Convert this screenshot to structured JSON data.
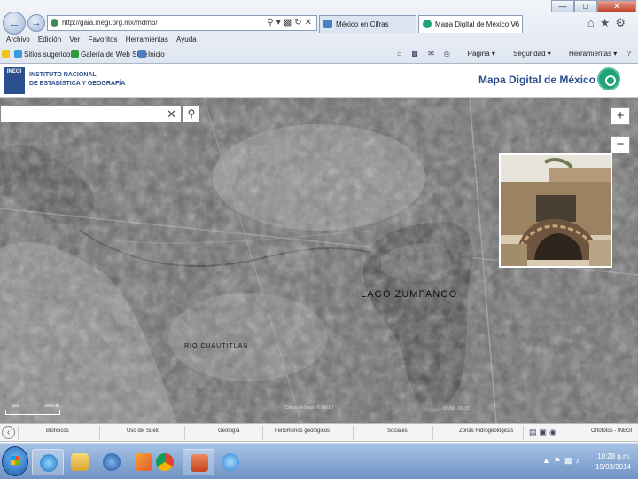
{
  "browser": {
    "address": "http://gaia.inegi.org.mx/mdm6/",
    "tabs": [
      {
        "label": "México en Cifras"
      },
      {
        "label": "Mapa Digital de México V6"
      }
    ],
    "tab_close": "×",
    "window_controls": [
      "—",
      "□",
      "✕"
    ],
    "menu": [
      "Archivo",
      "Edición",
      "Ver",
      "Favoritos",
      "Herramientas",
      "Ayuda"
    ],
    "favorites": [
      "Sitios sugeridos",
      "Galería de Web Slice",
      "Inicio"
    ],
    "command_bar": [
      "Página",
      "Seguridad",
      "Herramientas"
    ]
  },
  "site": {
    "org_line1": "INSTITUTO NACIONAL",
    "org_line2": "DE ESTADÍSTICA Y GEOGRAFÍA",
    "logo_text": "INEGI",
    "title": "Mapa Digital de México"
  },
  "map": {
    "search_placeholder": "",
    "search_clear": "✕",
    "zoom_in": "+",
    "zoom_out": "−",
    "label_lake": "LAGO  ZUMPANGO",
    "label_river": "RIO CUAUTITLAN",
    "scale_left": "500",
    "scale_right": "2000 m",
    "copyright": "Datos de Mapa © INEGI",
    "coords": "19.80, -99.15"
  },
  "theme_bar": {
    "items": [
      "Biofísicos",
      "Uso del Suelo",
      "Geología",
      "Fenómenos geológicos",
      "Sociales",
      "Zonas Hidrogeológicas"
    ],
    "credit": "Ortofotos - INEGI"
  },
  "taskbar": {
    "time": "10:28 p.m.",
    "date": "19/03/2014"
  }
}
